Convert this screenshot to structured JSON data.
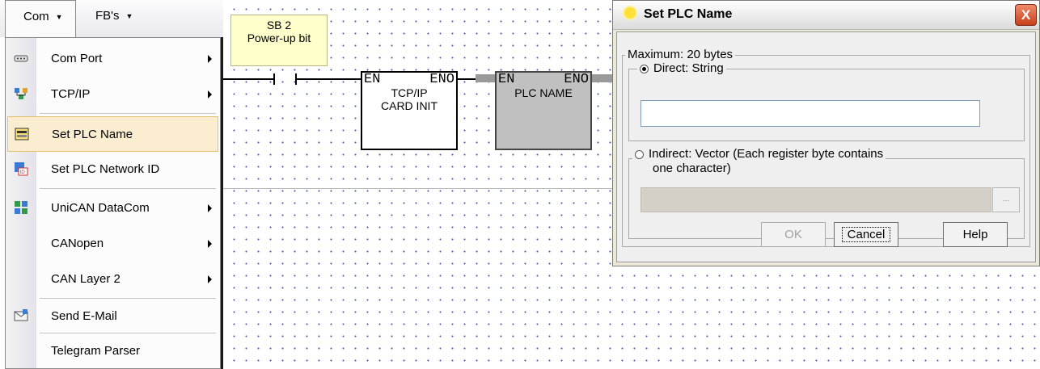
{
  "menubar": {
    "com": "Com",
    "fbs": "FB's"
  },
  "menu": {
    "items": [
      {
        "label": "Com Port",
        "submenu": true,
        "icon": "serial-port-icon"
      },
      {
        "label": "TCP/IP",
        "submenu": true,
        "icon": "network-icon"
      },
      {
        "label": "Set PLC Name",
        "submenu": false,
        "icon": "plc-name-icon",
        "highlighted": true
      },
      {
        "label": "Set PLC Network ID",
        "submenu": false,
        "icon": "network-id-icon"
      },
      {
        "label": "UniCAN DataCom",
        "submenu": true,
        "icon": "can-datacom-icon"
      },
      {
        "label": "CANopen",
        "submenu": true,
        "icon": ""
      },
      {
        "label": "CAN Layer 2",
        "submenu": true,
        "icon": ""
      },
      {
        "label": "Send E-Mail",
        "submenu": false,
        "icon": "email-icon"
      },
      {
        "label": "Telegram Parser",
        "submenu": false,
        "icon": ""
      }
    ]
  },
  "ladder": {
    "comment_line1": "SB 2",
    "comment_line2": "Power-up bit",
    "block1": {
      "en": "EN",
      "eno": "ENO",
      "line1": "TCP/IP",
      "line2": "CARD INIT"
    },
    "block2": {
      "en": "EN",
      "eno": "ENO",
      "line1": "PLC NAME"
    }
  },
  "dialog": {
    "title": "Set PLC Name",
    "close": "X",
    "group_label": "Maximum: 20 bytes",
    "direct_label": "Direct: String",
    "direct_value": "",
    "indirect_label_line1": "Indirect: Vector (Each register byte contains",
    "indirect_label_line2": "one character)",
    "indirect_value": "",
    "browse": "...",
    "ok": "OK",
    "cancel": "Cancel",
    "help": "Help"
  }
}
